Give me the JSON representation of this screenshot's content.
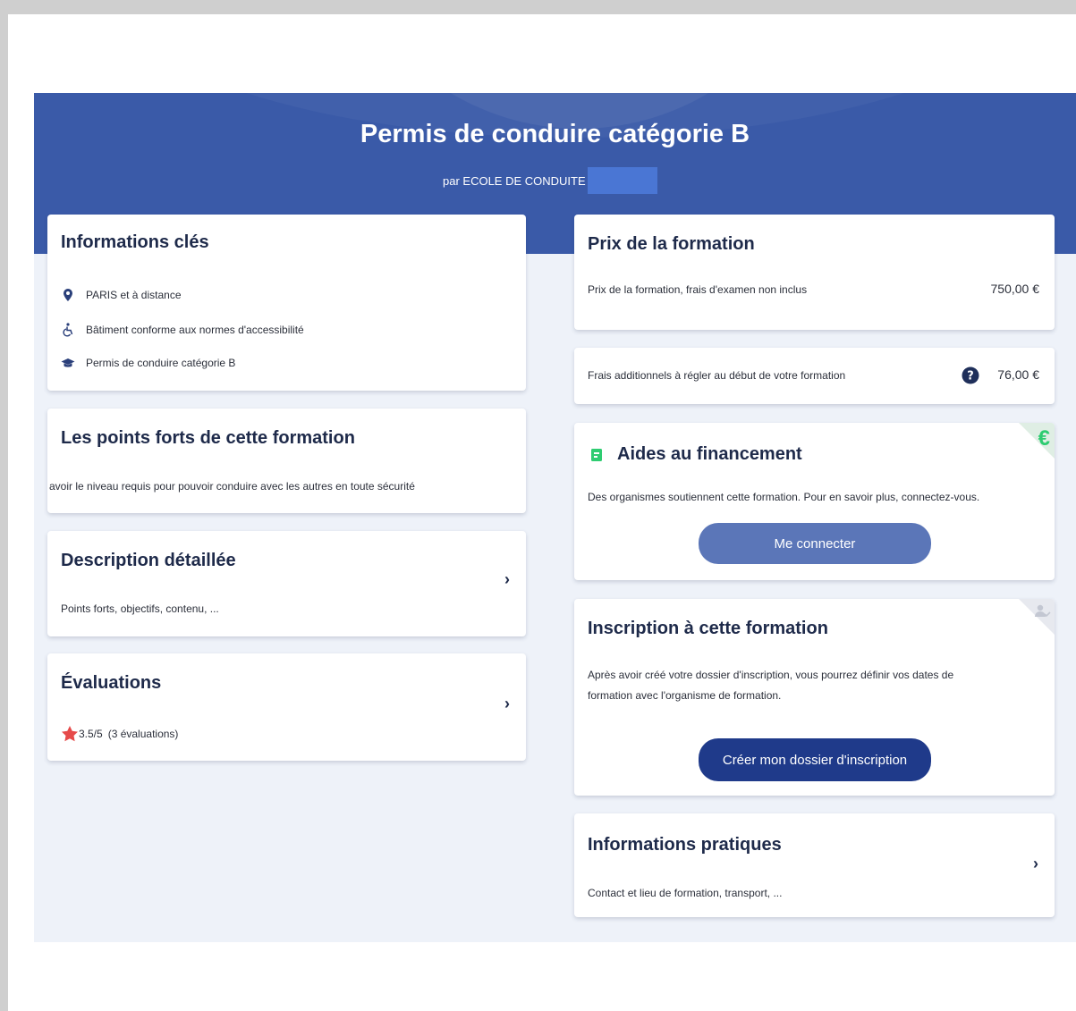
{
  "header": {
    "title": "Permis de conduire catégorie B",
    "by_text": "par ECOLE DE CONDUITE"
  },
  "key_info": {
    "title": "Informations clés",
    "items": [
      {
        "icon": "location-pin-icon",
        "text": "PARIS et à distance"
      },
      {
        "icon": "wheelchair-icon",
        "text": "Bâtiment conforme aux normes d'accessibilité"
      },
      {
        "icon": "graduation-cap-icon",
        "text": "Permis de conduire catégorie B"
      }
    ]
  },
  "strengths": {
    "title": "Les points forts de cette formation",
    "text": "avoir le niveau requis pour pouvoir conduire avec les autres en toute sécurité"
  },
  "description": {
    "title": "Description détaillée",
    "text": "Points forts, objectifs, contenu, ..."
  },
  "evaluations": {
    "title": "Évaluations",
    "rating": "3.5/5",
    "count": "(3 évaluations)"
  },
  "price": {
    "title": "Prix de la formation",
    "label": "Prix de la formation, frais d'examen non inclus",
    "value": "750,00 €"
  },
  "extra_fees": {
    "label": "Frais additionnels à régler au début de votre formation",
    "value": "76,00 €"
  },
  "funding": {
    "title": "Aides au financement",
    "text": "Des organismes soutiennent cette formation. Pour en savoir plus, connectez-vous.",
    "button": "Me connecter",
    "corner_symbol": "€"
  },
  "registration": {
    "title": "Inscription à cette formation",
    "text_line1": "Après avoir créé votre dossier d'inscription, vous pourrez définir vos dates de",
    "text_line2": "formation avec l'organisme de formation.",
    "button": "Créer mon dossier d'inscription"
  },
  "practical": {
    "title": "Informations pratiques",
    "text": "Contact et lieu de formation, transport, ..."
  },
  "colors": {
    "banner": "#3a5aa8",
    "page_bg": "#eef2f9",
    "button_primary": "#1f3a8a",
    "button_secondary": "#5b76b8",
    "star": "#e64a4a",
    "funding_accent": "#2ecc71"
  }
}
